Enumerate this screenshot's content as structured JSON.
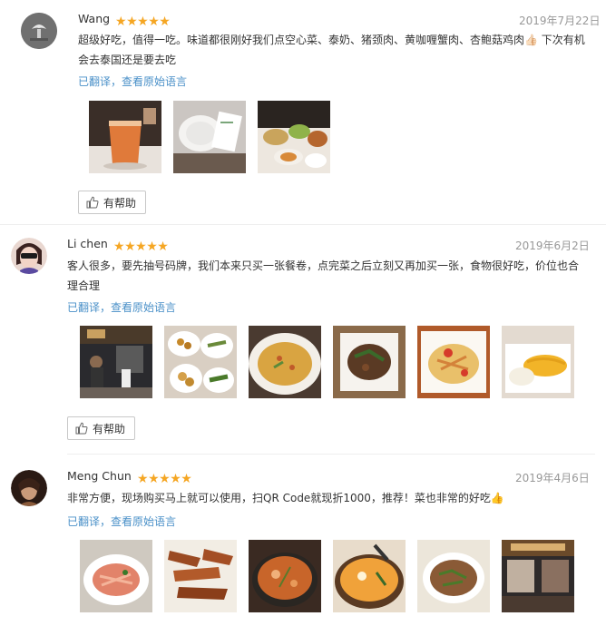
{
  "ui": {
    "stars": [
      "★",
      "★",
      "★",
      "★",
      "★"
    ],
    "star_color": "#f5a623",
    "link_color": "#4a90c8",
    "thumb_icon": "thumbs-up-icon"
  },
  "reviews": [
    {
      "name": "Wang",
      "date": "2019年7月22日",
      "content": "超级好吃，值得一吃。味道都很刚好我们点空心菜、泰奶、猪颈肉、黄咖喱蟹肉、杏鲍菇鸡肉👍🏻 下次有机会去泰国还是要去吃",
      "translate": "已翻译，查看原始语言",
      "helpful": "有帮助",
      "photos": [
        "thai-milk-tea",
        "plate-table",
        "table-dishes"
      ]
    },
    {
      "name": "Li chen",
      "date": "2019年6月2日",
      "content": "客人很多，要先抽号码牌，我们本来只买一张餐卷，点完菜之后立刻又再加买一张，食物很好吃，价位也合理合理",
      "translate": "已翻译，查看原始语言",
      "helpful": "有帮助",
      "photos": [
        "restaurant-queue",
        "fried-dishes",
        "fried-rice",
        "stir-fry-beef",
        "papaya-salad",
        "mango-sticky-rice"
      ]
    },
    {
      "name": "Meng Chun",
      "date": "2019年4月6日",
      "content": "非常方便，现场购买马上就可以使用，扫QR Code就现折1000，推荐！菜也非常的好吃👍",
      "translate": "已翻译，查看原始语言",
      "photos": [
        "shrimp-salad",
        "grilled-pork",
        "tom-yum-soup",
        "yellow-curry",
        "larb-salad",
        "restaurant-interior"
      ]
    }
  ]
}
